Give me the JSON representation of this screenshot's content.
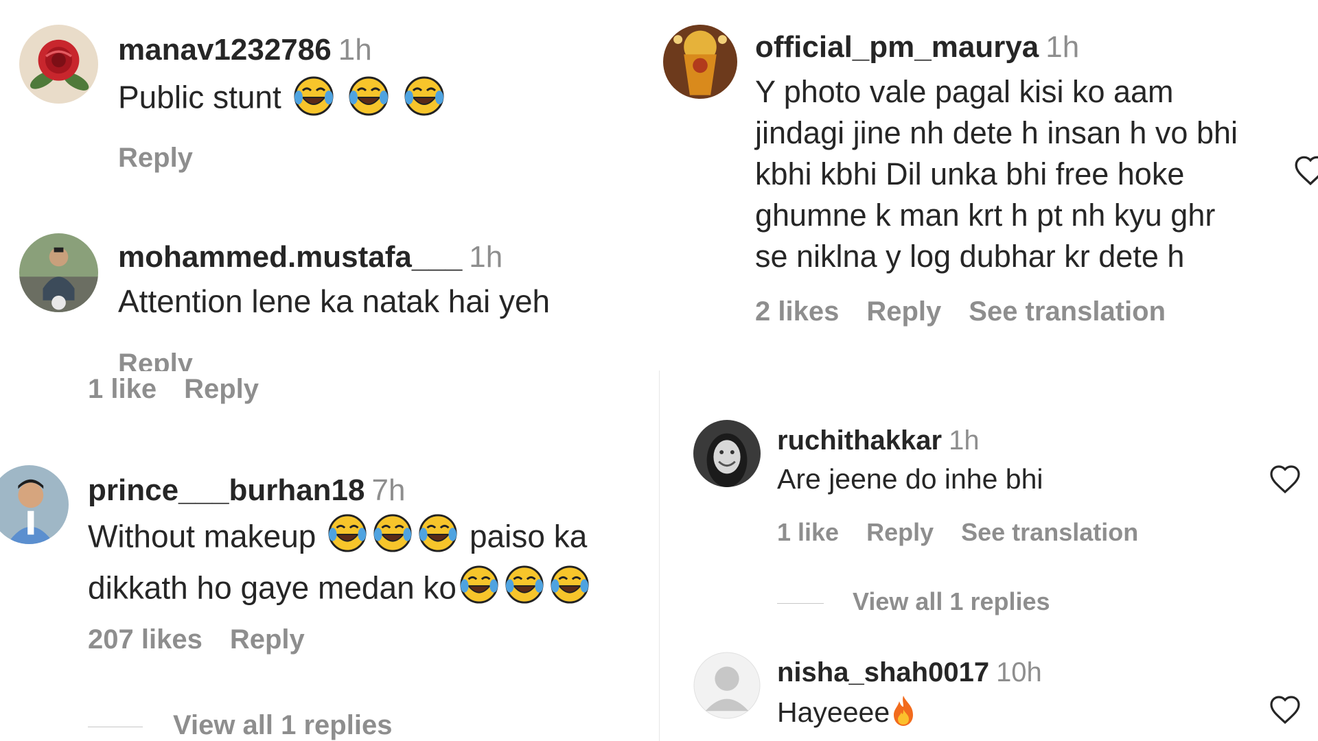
{
  "colors": {
    "text": "#262626",
    "muted": "#8e8e8e",
    "divider": "#e6e6e6",
    "emoji_face": "#f7c52b",
    "emoji_tear": "#4fa3e0"
  },
  "comments": [
    {
      "username": "manav1232786",
      "time": "1h",
      "text": [
        "Public stunt"
      ],
      "emoji_suffix": "3x face-with-tears-of-joy",
      "reply": "Reply"
    },
    {
      "username": "mohammed.mustafa___",
      "time": "1h",
      "text": [
        "Attention lene ka natak hai yeh"
      ],
      "reply": "Reply"
    },
    {
      "likes": "1 like",
      "reply": "Reply"
    },
    {
      "username": "prince___burhan18",
      "time": "7h",
      "text_a": "Without makeup",
      "text_b": "paiso ka",
      "text_c": "dikkath ho gaye medan ko",
      "likes": "207 likes",
      "reply": "Reply",
      "view_replies": "View all 1 replies"
    },
    {
      "username": "official_pm_maurya",
      "time": "1h",
      "text": [
        "Y photo vale pagal kisi ko aam",
        "jindagi jine nh dete h insan h vo bhi",
        "kbhi kbhi Dil unka bhi free hoke",
        "ghumne k man krt h pt nh kyu ghr",
        "se niklna y log dubhar kr dete h"
      ],
      "likes": "2 likes",
      "reply": "Reply",
      "translation": "See translation"
    },
    {
      "username": "ruchithakkar",
      "time": "1h",
      "text": [
        "Are jeene do inhe bhi"
      ],
      "likes": "1 like",
      "reply": "Reply",
      "translation": "See translation",
      "view_replies": "View all 1 replies"
    },
    {
      "username": "nisha_shah0017",
      "time": "10h",
      "text": [
        "Hayeeee"
      ],
      "emoji_suffix": "fire"
    }
  ]
}
